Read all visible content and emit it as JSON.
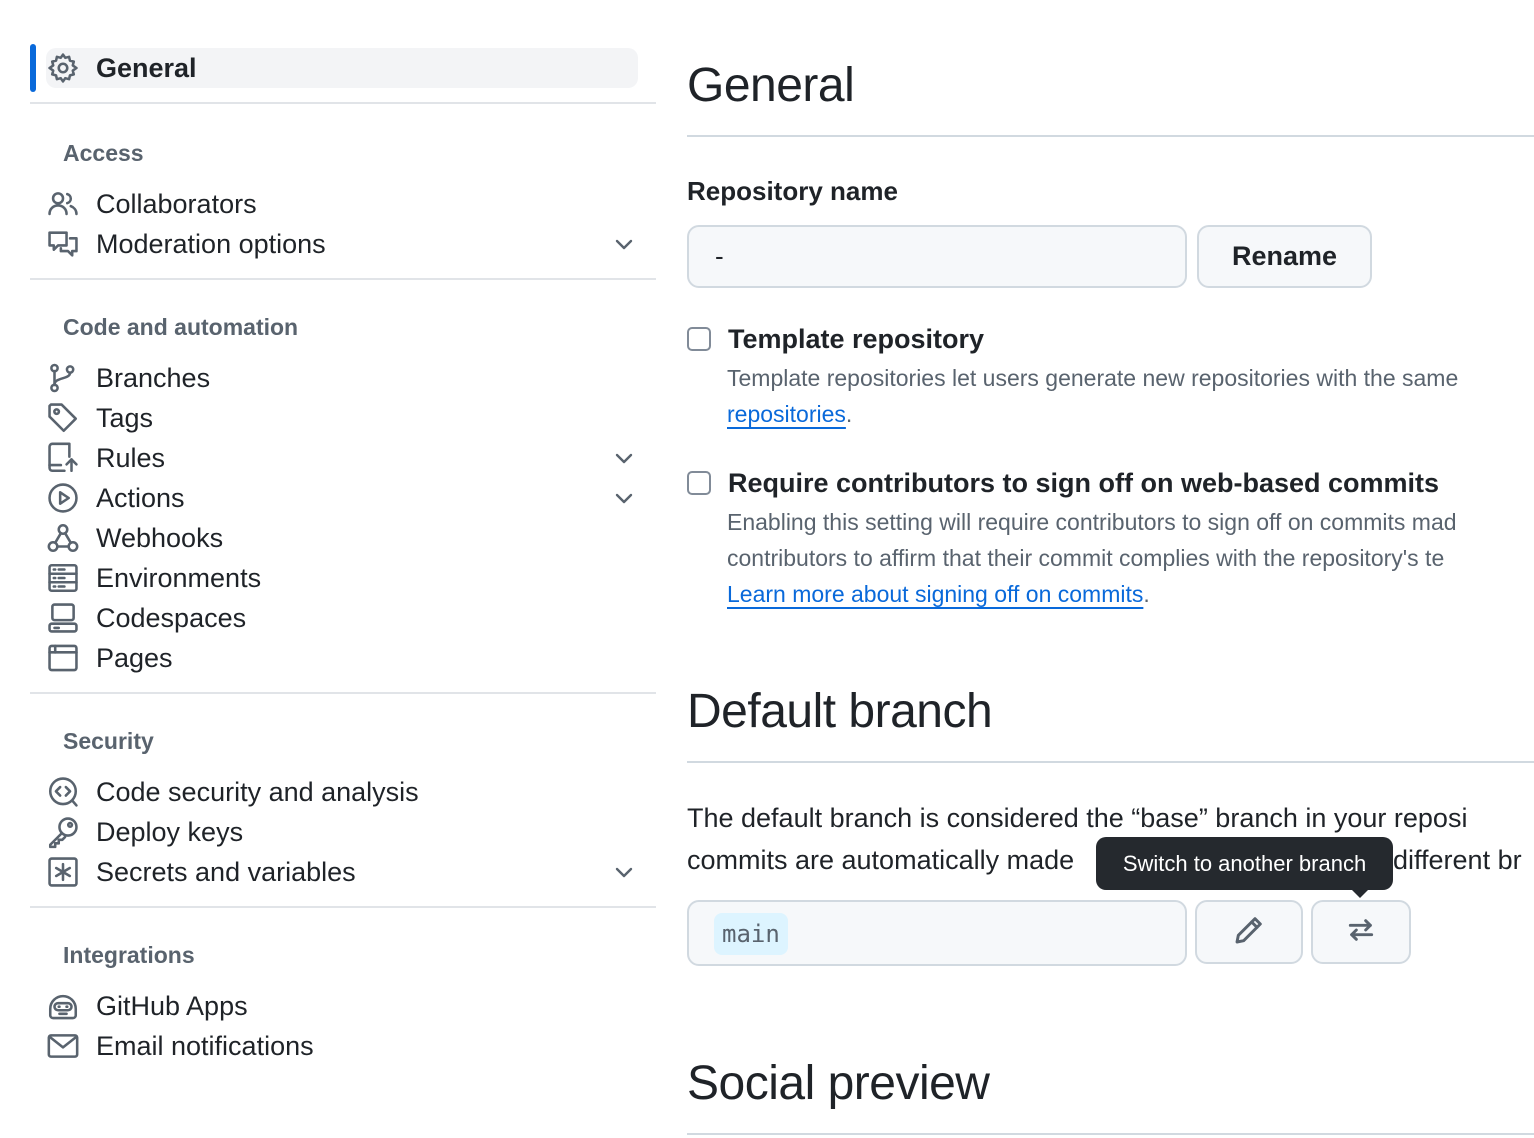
{
  "sidebar": {
    "general": {
      "label": "General",
      "icon": "gear-icon"
    },
    "groups": [
      {
        "heading": "Access"
      },
      {
        "heading": "Code and automation"
      },
      {
        "heading": "Security"
      },
      {
        "heading": "Integrations"
      }
    ],
    "access": [
      {
        "label": "Collaborators",
        "icon": "people-icon"
      },
      {
        "label": "Moderation options",
        "icon": "comment-discussion-icon"
      }
    ],
    "code": [
      {
        "label": "Branches",
        "icon": "git-branch-icon"
      },
      {
        "label": "Tags",
        "icon": "tag-icon"
      },
      {
        "label": "Rules",
        "icon": "repo-push-icon"
      },
      {
        "label": "Actions",
        "icon": "play-icon"
      },
      {
        "label": "Webhooks",
        "icon": "webhook-icon"
      },
      {
        "label": "Environments",
        "icon": "server-icon"
      },
      {
        "label": "Codespaces",
        "icon": "codespaces-icon"
      },
      {
        "label": "Pages",
        "icon": "browser-icon"
      }
    ],
    "security": [
      {
        "label": "Code security and analysis",
        "icon": "codescan-icon"
      },
      {
        "label": "Deploy keys",
        "icon": "key-icon"
      },
      {
        "label": "Secrets and variables",
        "icon": "key-asterisk-icon"
      }
    ],
    "integrations": [
      {
        "label": "GitHub Apps",
        "icon": "hubot-icon"
      },
      {
        "label": "Email notifications",
        "icon": "mail-icon"
      }
    ]
  },
  "main": {
    "title": "General",
    "repo_name_label": "Repository name",
    "repo_name_value": "-",
    "rename_button": "Rename",
    "template": {
      "title": "Template repository",
      "desc_line1": "Template repositories let users generate new repositories with the same",
      "link": "repositories",
      "after_link": "."
    },
    "signoff": {
      "title": "Require contributors to sign off on web-based commits",
      "desc_line1": "Enabling this setting will require contributors to sign off on commits mad",
      "desc_line2": "contributors to affirm that their commit complies with the repository's te",
      "link": "Learn more about signing off on commits",
      "after_link": "."
    },
    "default_branch": {
      "heading": "Default branch",
      "line1": "The default branch is considered the “base” branch in your reposi",
      "line2_part1": "commits are automatically made",
      "line2_part2": "different br",
      "branch": "main",
      "tooltip": "Switch to another branch"
    },
    "social_preview_heading": "Social preview"
  },
  "colors": {
    "accent": "#0969da",
    "muted": "#59636e",
    "border": "#d1d9e0"
  }
}
